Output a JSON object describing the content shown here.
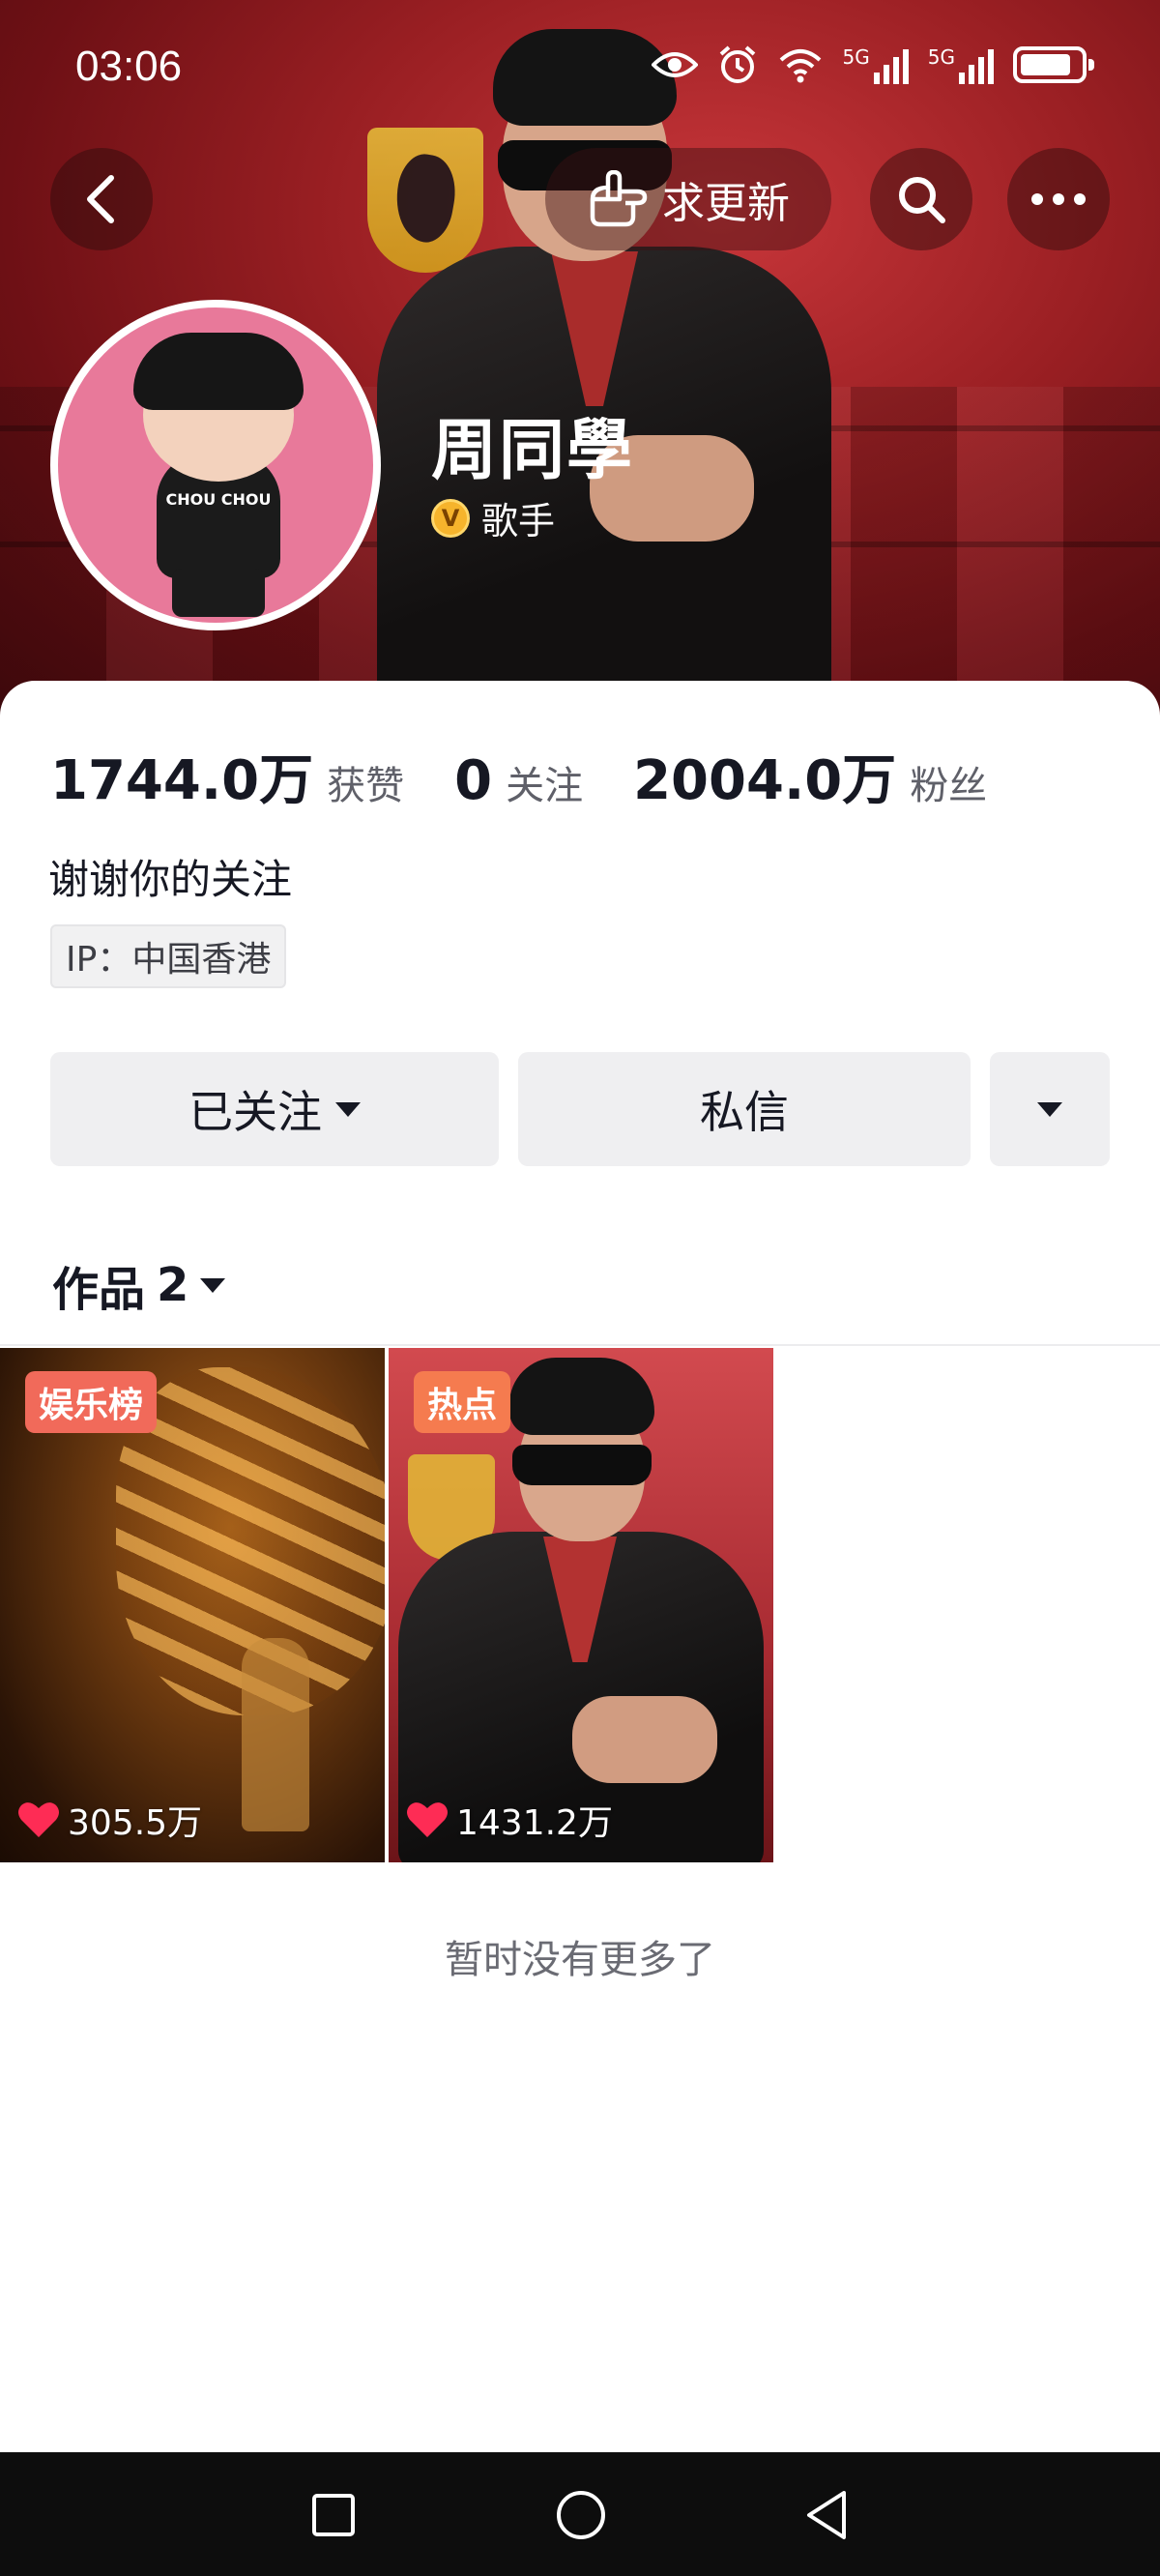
{
  "status_bar": {
    "time": "03:06",
    "network_1": "5G",
    "network_2": "5G",
    "battery_level": 0.85
  },
  "header": {
    "update_button_label": "求更新",
    "profile_name": "周同學",
    "verified_badge": "V",
    "verified_title": "歌手",
    "avatar_shirt_text": "CHOU CHOU"
  },
  "stats": [
    {
      "value": "1744.0万",
      "label": "获赞"
    },
    {
      "value": "0",
      "label": "关注"
    },
    {
      "value": "2004.0万",
      "label": "粉丝"
    }
  ],
  "bio": "谢谢你的关注",
  "ip_location": "IP：中国香港",
  "actions": {
    "follow_label": "已关注",
    "message_label": "私信"
  },
  "works": {
    "label": "作品",
    "count": "2",
    "items": [
      {
        "tag": "娱乐榜",
        "likes": "305.5万"
      },
      {
        "tag": "热点",
        "likes": "1431.2万"
      }
    ],
    "end_note": "暂时没有更多了"
  },
  "colors": {
    "header_red": "#9a1f23",
    "tag_rank": "#f16a5a",
    "tag_hot": "#f57b4f",
    "like_heart": "#fe2c55",
    "verified_gold": "#f6b42c"
  },
  "icons": [
    "back-icon",
    "pointing-hand-icon",
    "search-icon",
    "more-icon",
    "eye-icon",
    "alarm-icon",
    "wifi-icon",
    "signal-icon",
    "battery-icon",
    "heart-icon",
    "square-icon",
    "circle-icon",
    "triangle-back-icon"
  ]
}
